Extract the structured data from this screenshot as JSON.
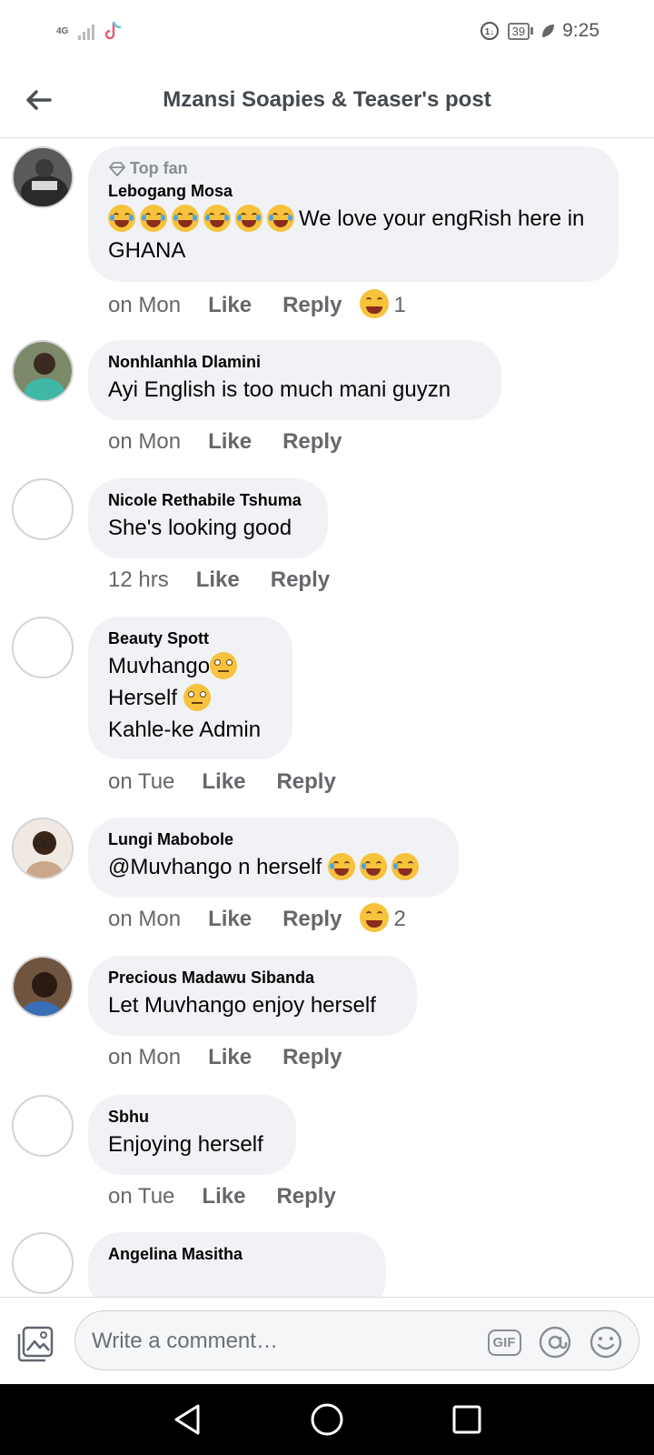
{
  "status_bar": {
    "network": "4G",
    "network_sub": "1↓.ıl",
    "battery": "39",
    "time": "9:25",
    "icons": [
      "signal-icon",
      "tiktok-icon",
      "data-saver-icon",
      "battery-icon",
      "leaf-icon"
    ]
  },
  "header": {
    "title": "Mzansi Soapies & Teaser's post"
  },
  "comments": [
    {
      "badge": "Top fan",
      "author": "Lebogang Mosa",
      "lines": [
        "We love your engRish here in",
        "GHANA"
      ],
      "time": "on Mon",
      "like": "Like",
      "reply": "Reply",
      "reaction_count": "1"
    },
    {
      "author": "Nonhlanhla Dlamini",
      "lines": [
        "Ayi English is too much mani guyzn"
      ],
      "time": "on Mon",
      "like": "Like",
      "reply": "Reply"
    },
    {
      "author": "Nicole Rethabile Tshuma",
      "lines": [
        "She's looking good"
      ],
      "time": "12 hrs",
      "like": "Like",
      "reply": "Reply"
    },
    {
      "author": "Beauty Spott",
      "lines": [
        "Muvhango",
        "Herself ",
        "Kahle-ke Admin"
      ],
      "time": "on Tue",
      "like": "Like",
      "reply": "Reply"
    },
    {
      "author": "Lungi Mabobole",
      "lines": [
        "@Muvhango n herself "
      ],
      "time": "on Mon",
      "like": "Like",
      "reply": "Reply",
      "reaction_count": "2"
    },
    {
      "author": "Precious Madawu Sibanda",
      "lines": [
        "Let Muvhango enjoy herself"
      ],
      "time": "on Mon",
      "like": "Like",
      "reply": "Reply"
    },
    {
      "author": "Sbhu",
      "lines": [
        "Enjoying herself"
      ],
      "time": "on Tue",
      "like": "Like",
      "reply": "Reply"
    },
    {
      "author": "Angelina Masitha"
    }
  ],
  "composer": {
    "placeholder": "Write a comment…",
    "gif_label": "GIF"
  },
  "colors": {
    "bubble": "#f0f2f5",
    "meta_text": "#65676b",
    "nav_bar": "#000000"
  }
}
